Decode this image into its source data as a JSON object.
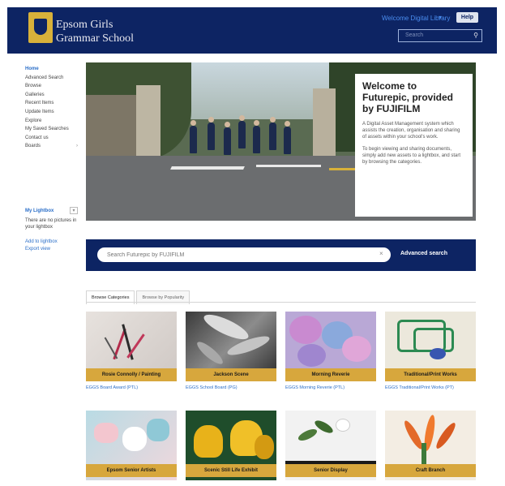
{
  "header": {
    "school_line1": "Epsom Girls",
    "school_line2": "Grammar School",
    "welcome": "Welcome Digital Library",
    "welcome_chevron": "▾",
    "help": "Help",
    "search_placeholder": "Search",
    "search_icon": "search-icon"
  },
  "sidebar": {
    "items": [
      {
        "label": "Home"
      },
      {
        "label": "Advanced Search"
      },
      {
        "label": "Browse"
      },
      {
        "label": "Galleries"
      },
      {
        "label": "Recent Items"
      },
      {
        "label": "Update Items"
      },
      {
        "label": "Explore"
      },
      {
        "label": "My Saved Searches"
      },
      {
        "label": "Contact us"
      },
      {
        "label": "Boards",
        "chevron": "›"
      }
    ],
    "lightbox": {
      "title": "My Lightbox",
      "caret": "▾",
      "empty_text": "There are no pictures in your lightbox",
      "links": [
        "Add to lightbox",
        "Export view"
      ]
    }
  },
  "hero": {
    "heading": "Welcome to Futurepic, provided by FUJIFILM",
    "para1": "A Digital Asset Management system which assists the creation, organisation and sharing of assets within your school's work.",
    "para2": "To begin viewing and sharing documents, simply add new assets to a lightbox, and start by browsing the categories."
  },
  "search": {
    "placeholder": "Search Futurepic by FUJIFILM",
    "clear_icon": "×",
    "advanced": "Advanced search"
  },
  "tabs": [
    "Browse Categories",
    "Browse by Popularity"
  ],
  "cards": [
    {
      "label": "Rosie Connolly / Painting",
      "link": "EGGS Board Award (PTL)"
    },
    {
      "label": "Jackson Scene",
      "link": "EGGS School Board (PG)"
    },
    {
      "label": "Morning Reverie",
      "link": "EGGS Morning Reverie (PTL)"
    },
    {
      "label": "Traditional/Print Works",
      "link": "EGGS Traditional/Print Works (PT)"
    },
    {
      "label": "Epsom Senior Artists",
      "link": ""
    },
    {
      "label": "Scenic Still Life Exhibit",
      "link": ""
    },
    {
      "label": "Senior Display",
      "link": ""
    },
    {
      "label": "Craft Branch",
      "link": ""
    }
  ],
  "colors": {
    "navy": "#0d2463",
    "gold": "#d7a73d",
    "link_blue": "#2a6ec8"
  }
}
